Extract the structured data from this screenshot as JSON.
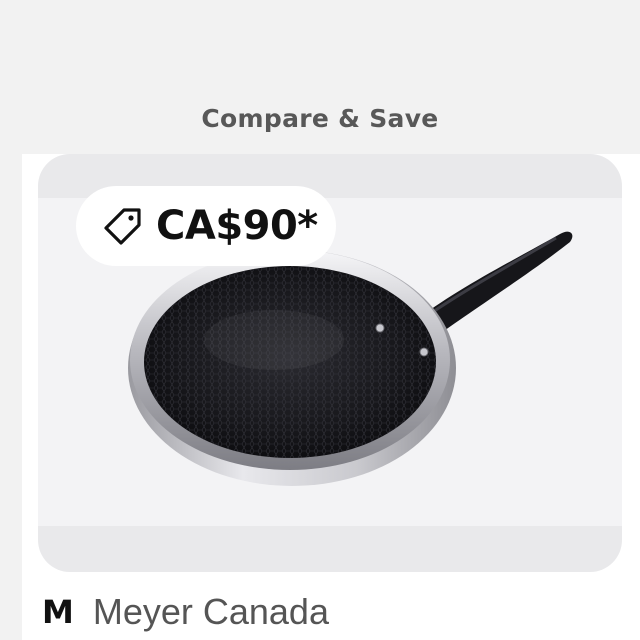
{
  "section": {
    "title": "Compare & Save"
  },
  "product": {
    "price": "CA$90*",
    "brand_logo_letter": "M",
    "brand_name": "Meyer Canada"
  },
  "icons": {
    "price_tag": "price-tag-icon",
    "product_image": "frying-pan-image"
  },
  "colors": {
    "background": "#f2f2f2",
    "card": "#ffffff",
    "image_frame": "#e9e9eb",
    "title_text": "#585858",
    "price_text": "#111111",
    "brand_text": "#555555"
  }
}
